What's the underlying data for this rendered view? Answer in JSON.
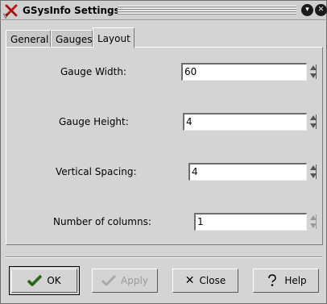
{
  "window": {
    "title": "GSysInfo Settings",
    "icons": {
      "app": "x-app-icon",
      "menu": "window-menu-icon",
      "minimize": "minimize-icon",
      "close": "close-icon"
    }
  },
  "tabs": [
    {
      "label": "General",
      "active": false
    },
    {
      "label": "Gauges",
      "active": false
    },
    {
      "label": "Layout",
      "active": true
    }
  ],
  "layout": {
    "rows": [
      {
        "label": "Gauge Width:",
        "value": "60"
      },
      {
        "label": "Gauge Height:",
        "value": "4"
      },
      {
        "label": "Vertical Spacing:",
        "value": "4"
      },
      {
        "label": "Number of columns:",
        "value": "1"
      }
    ]
  },
  "buttons": {
    "ok": "OK",
    "apply": "Apply",
    "close": "Close",
    "help": "Help"
  },
  "colors": {
    "background": "#d4d4d4",
    "accent_check": "#3d7a2c"
  }
}
